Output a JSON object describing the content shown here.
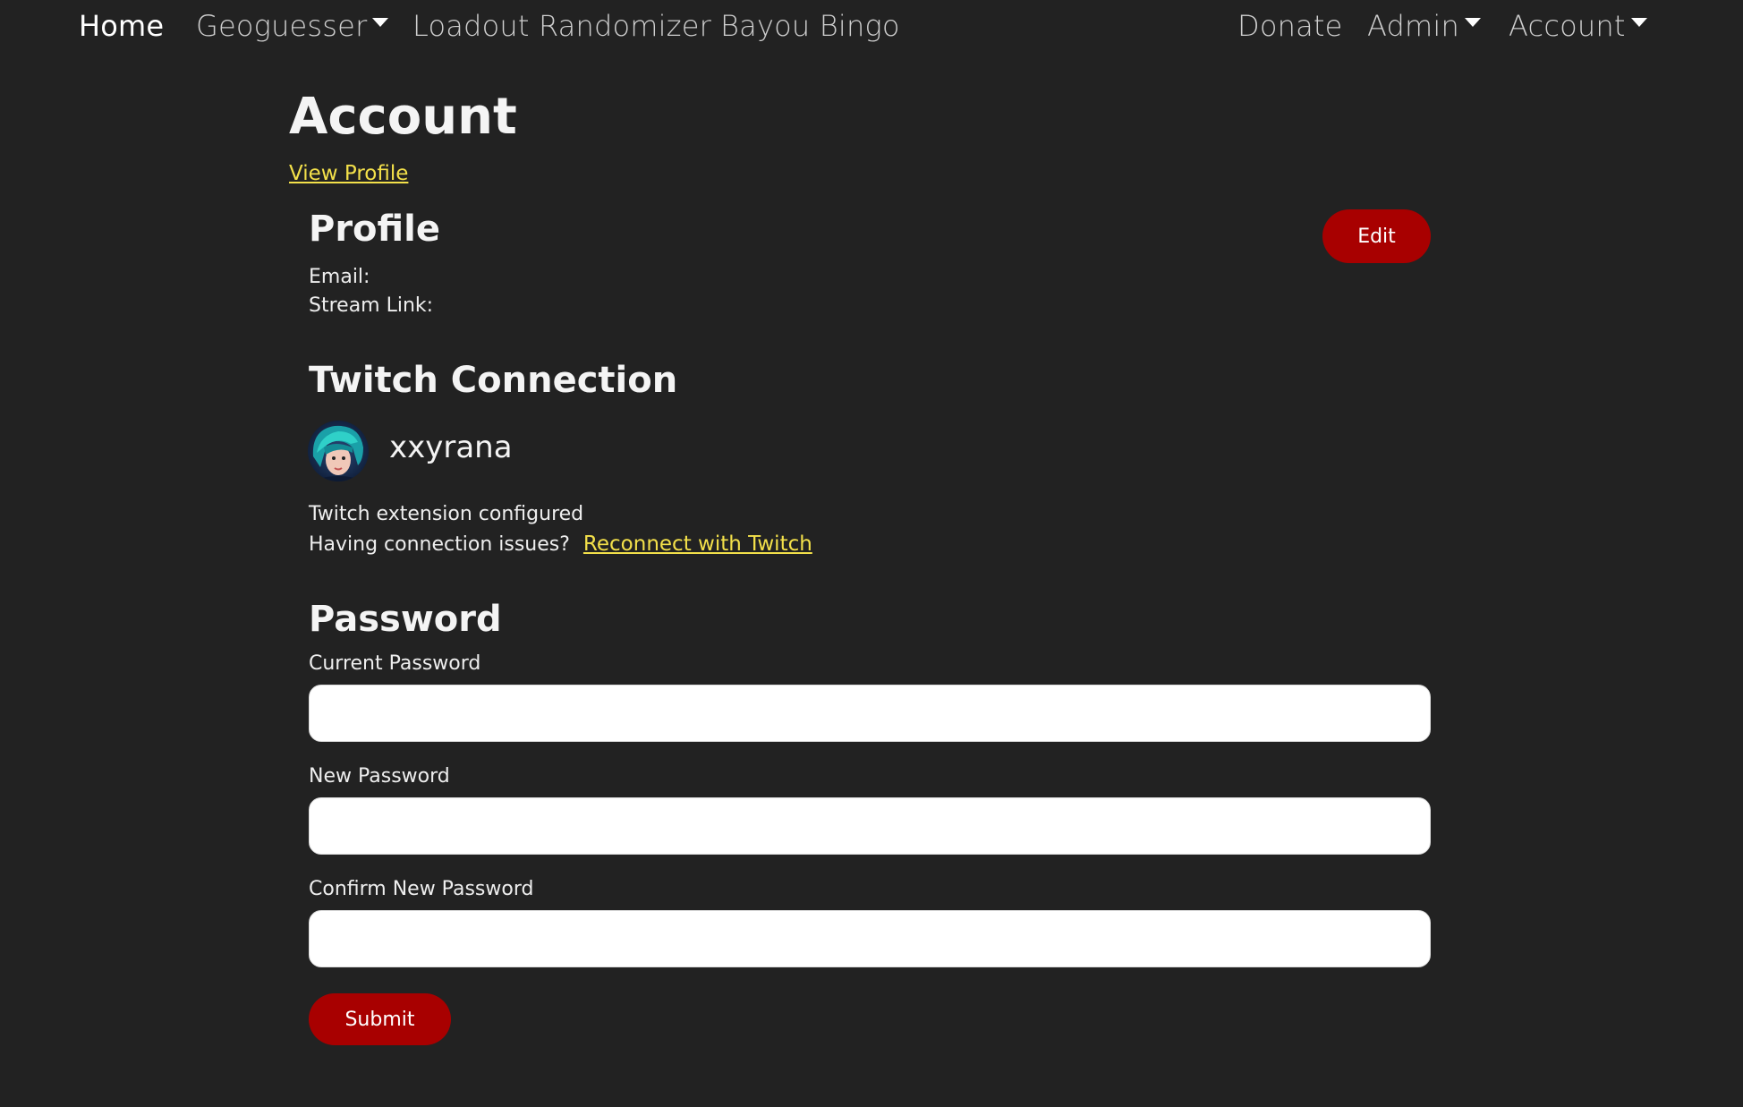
{
  "nav": {
    "home": "Home",
    "geoguesser": "Geoguesser",
    "loadout": "Loadout Randomizer",
    "bingo": "Bayou Bingo",
    "donate": "Donate",
    "admin": "Admin",
    "account": "Account"
  },
  "page": {
    "title": "Account",
    "view_profile": "View Profile"
  },
  "profile": {
    "heading": "Profile",
    "edit": "Edit",
    "email_label": "Email:",
    "stream_label": "Stream Link:"
  },
  "twitch": {
    "heading": "Twitch Connection",
    "username": "xxyrana",
    "status": "Twitch extension configured",
    "issues": "Having connection issues?",
    "reconnect": "Reconnect with Twitch"
  },
  "password": {
    "heading": "Password",
    "current_label": "Current Password",
    "new_label": "New Password",
    "confirm_label": "Confirm New Password",
    "current_value": "",
    "new_value": "",
    "confirm_value": "",
    "submit": "Submit"
  },
  "colors": {
    "background": "#222222",
    "accent": "#a80000",
    "link": "#f3e04a"
  }
}
